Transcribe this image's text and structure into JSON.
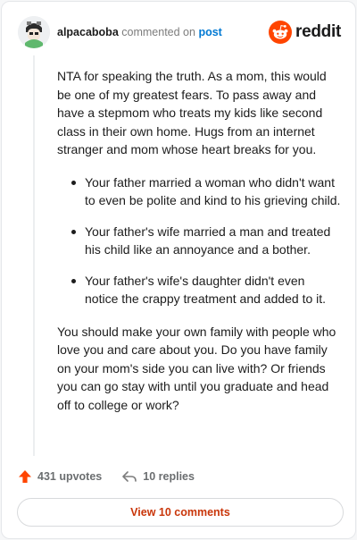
{
  "header": {
    "username": "alpacaboba",
    "action_text": "commented on",
    "target_text": "post",
    "brand": "reddit"
  },
  "comment": {
    "paragraph_1": "NTA for speaking the truth. As a mom, this would be one of my greatest fears. To pass away and have a stepmom who treats my kids like second class in their own home. Hugs from an internet stranger and mom whose heart breaks for you.",
    "bullets": [
      "Your father married a woman who didn't want to even be polite and kind to his grieving child.",
      "Your father's wife married a man and treated his child like an annoyance and a bother.",
      "Your father's wife's daughter didn't even notice the crappy treatment and added to it."
    ],
    "paragraph_2": "You should make your own family with people who love you and care about you. Do you have family on your mom's side you can live with? Or friends you can go stay with until you graduate and head off to college or work?"
  },
  "actions": {
    "upvotes": "431 upvotes",
    "replies": "10 replies",
    "view_comments": "View 10 comments"
  },
  "colors": {
    "accent_orange": "#ff4500",
    "link_blue": "#0079d3",
    "view_text": "#c9360a"
  },
  "icons": {
    "upvote": "upvote-arrow-icon",
    "reply": "reply-arrow-icon",
    "brand": "reddit-alien-icon"
  }
}
